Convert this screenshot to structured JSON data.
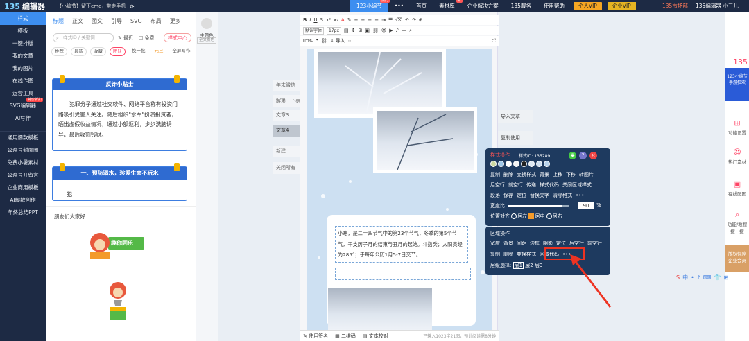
{
  "app": {
    "logo_mark": "135",
    "name": "编辑器",
    "notice": "【小编节】留下emo，带走手机"
  },
  "topnav": [
    {
      "label": "123小编节",
      "active": true,
      "hot": "热门"
    },
    {
      "label": "•••"
    },
    {
      "label": "首页"
    },
    {
      "label": "素材库",
      "hot": "新"
    },
    {
      "label": "企业解决方案"
    },
    {
      "label": "135服务"
    },
    {
      "label": "使用帮助"
    },
    {
      "label": "个人VIP",
      "kind": "vip"
    },
    {
      "label": "企业VIP",
      "kind": "vip2"
    }
  ],
  "market": "135市场部",
  "user": "135编辑器 小三儿",
  "left_sidebar": [
    {
      "label": "样式",
      "active": true
    },
    {
      "label": "模板"
    },
    {
      "label": "一键排版"
    },
    {
      "label": "我的文章"
    },
    {
      "label": "我的图片"
    },
    {
      "label": "在线作图"
    },
    {
      "label": "运营工具"
    },
    {
      "label": "SVG编辑器",
      "badge": "特价折扣"
    },
    {
      "label": "AI写作"
    },
    {
      "label": ""
    },
    {
      "label": "通用爆款模板"
    },
    {
      "label": "公众号封面图"
    },
    {
      "label": "免费小暑素材"
    },
    {
      "label": "公众号开留言"
    },
    {
      "label": "企业商用模板"
    },
    {
      "label": "AI爆款创作"
    },
    {
      "label": "年终总结PPT"
    }
  ],
  "style_panel": {
    "tabs": [
      "标题",
      "正文",
      "图文",
      "引导",
      "SVG",
      "布局",
      "更多"
    ],
    "search_placeholder": "样式ID / 关键词",
    "chips": [
      "最近",
      "免费"
    ],
    "style_center": "样式中心",
    "filters": [
      "推荐",
      "最新",
      "收藏",
      "团队",
      "换一批",
      "元旦",
      "全屏写作"
    ],
    "card1_title": "反诈小贴士",
    "card1_body": "犯罪分子通过社交软件、网络平台称有投资门路吸引受害人关注。随后组织\"水军\"扮演投资者，晒出虚假收益情况，通过小额返利，步步洗脑诱导，最后收割钱财。",
    "card2_title": "一、预防溺水，珍爱生命不玩水",
    "card2_body": "犯",
    "friends": "朋友们大家好",
    "mascot_banner": "趣你同乐"
  },
  "theme": {
    "label": "主题色",
    "sub": "全文换色"
  },
  "mid_buttons": [
    {
      "label": "年末微信"
    },
    {
      "label": "解第一下表"
    },
    {
      "label": "文章3"
    },
    {
      "label": "文章4",
      "dark": true
    },
    {
      "label": "新建"
    },
    {
      "label": "关闭所有"
    }
  ],
  "editor": {
    "font": "默认字体",
    "size": "17px",
    "text": "小寒，是二十四节气中的第23个节气，冬季的第5个节气，干支历子月的结束与丑月的起始。斗指癸；太阳黄经为285°；于每年公历1月5-7日交节。",
    "bottom": [
      "使用签名",
      "二维码",
      "文本校对"
    ],
    "count": "已输入1023字21图，预计阅读需8分钟"
  },
  "import_buttons": [
    "导入文章",
    "复制使用"
  ],
  "popover1": {
    "title": "样式操作",
    "style_id": "样式ID: 135289",
    "row1": [
      "复制",
      "删除",
      "变换样式",
      "背景",
      "上移",
      "下移",
      "转图片"
    ],
    "row2": [
      "后空行",
      "前空行",
      "传递",
      "样式代码",
      "关闭区域样式"
    ],
    "row3": [
      "段落",
      "保存",
      "定位",
      "替换文字",
      "清除格式",
      "•••"
    ],
    "width_label": "宽度比",
    "width_value": "90",
    "width_unit": "%",
    "width_fraction": 0.9,
    "align_label": "位置对齐",
    "align_opts": [
      "居左",
      "居中",
      "居右"
    ]
  },
  "popover2": {
    "title": "区域操作",
    "row1": [
      "宽度",
      "背景",
      "间距",
      "边框",
      "阴影",
      "定位",
      "后空行",
      "前空行"
    ],
    "row2": [
      "复制",
      "删除",
      "变换样式",
      "区域代码",
      "•••"
    ],
    "layer_label": "层级选择:",
    "layers": [
      "层1",
      "层2",
      "层3"
    ]
  },
  "right_rail": {
    "promo": "123小编节 手游狂欢",
    "items": [
      "功能设置",
      "热门素材",
      "在线配图",
      "功能/教程 搜一搜"
    ],
    "vip": "版权保障 企业会员",
    "ime": [
      "S",
      "中",
      "•",
      "♪",
      "⌨",
      "👕",
      "⊞"
    ]
  },
  "colors": {
    "dark": "#1d2a44",
    "accent": "#3d8ef0",
    "popover": "#1e3a5f",
    "highlight": "#e32"
  }
}
